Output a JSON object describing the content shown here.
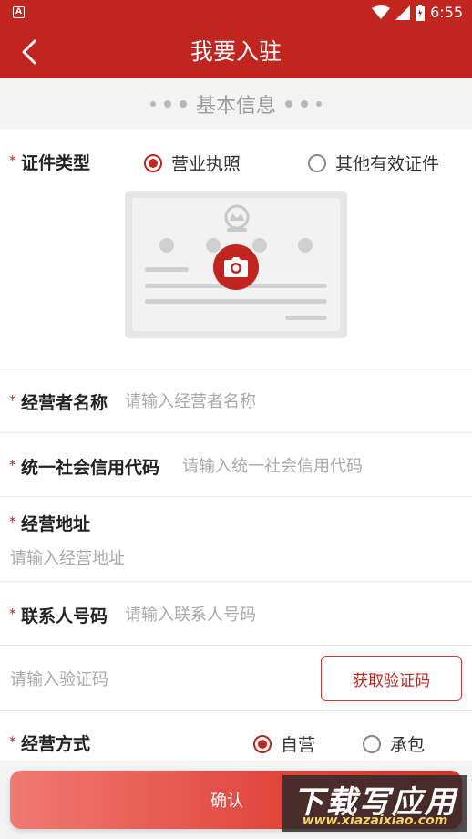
{
  "status_bar": {
    "time": "6:55",
    "notification_icon": "a-notification-icon",
    "icons": [
      "wifi-icon",
      "signal-icon",
      "battery-icon"
    ]
  },
  "app_bar": {
    "title": "我要入驻",
    "back_icon": "chevron-left-icon"
  },
  "section": {
    "title": "基本信息"
  },
  "license_type": {
    "required_mark": "*",
    "label": "证件类型",
    "options": [
      {
        "label": "营业执照",
        "selected": true
      },
      {
        "label": "其他有效证件",
        "selected": false
      }
    ],
    "upload_icon": "camera-icon"
  },
  "operator_name": {
    "required_mark": "*",
    "label": "经营者名称",
    "value": "",
    "placeholder": "请输入经营者名称"
  },
  "credit_code": {
    "required_mark": "*",
    "label": "统一社会信用代码",
    "value": "",
    "placeholder": "请输入统一社会信用代码"
  },
  "address": {
    "required_mark": "*",
    "label": "经营地址",
    "value": "",
    "placeholder": "请输入经营地址"
  },
  "contact_phone": {
    "required_mark": "*",
    "label": "联系人号码",
    "value": "",
    "placeholder": "请输入联系人号码"
  },
  "verify_code": {
    "value": "",
    "placeholder": "请输入验证码",
    "button_label": "获取验证码"
  },
  "business_mode": {
    "required_mark": "*",
    "label": "经营方式",
    "options": [
      {
        "label": "自营",
        "selected": true
      },
      {
        "label": "承包",
        "selected": false
      }
    ]
  },
  "footer": {
    "confirm_label": "确认"
  },
  "watermark": {
    "top": "下载写应用",
    "bottom": "www.xiazaixiao.com"
  },
  "colors": {
    "brand": "#c0251f",
    "placeholder": "#a9a9a9",
    "section_bg": "#f3f3f3"
  }
}
